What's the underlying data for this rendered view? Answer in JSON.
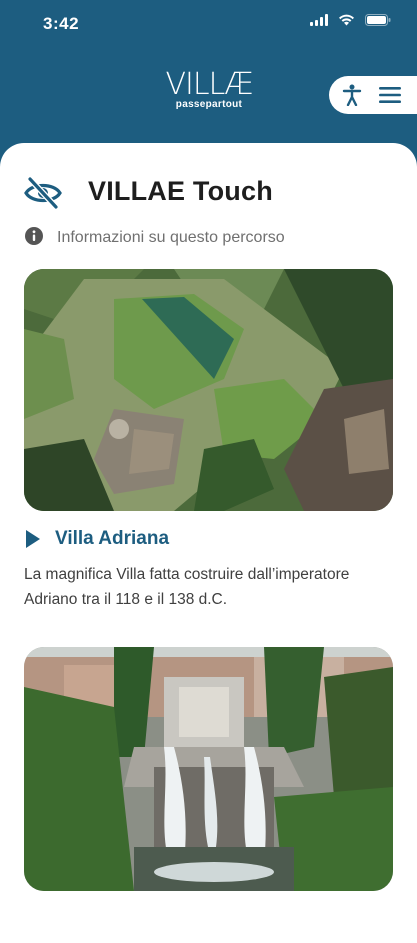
{
  "status_bar": {
    "time": "3:42"
  },
  "header": {
    "logo_main": "VILLÆ",
    "logo_sub": "passepartout"
  },
  "page": {
    "title": "VILLAE Touch",
    "info_text": "Informazioni su questo percorso"
  },
  "items": [
    {
      "title": "Villa Adriana",
      "description": "La magnifica Villa fatta costruire dall’imperatore Adriano tra il 118 e il 138 d.C."
    }
  ],
  "colors": {
    "brand": "#1d5d80",
    "text_dark": "#1e1e1e",
    "text_muted": "#707070"
  },
  "icons": {
    "status": [
      "signal-icon",
      "wifi-icon",
      "battery-icon"
    ],
    "header": [
      "accessibility-icon",
      "menu-icon"
    ],
    "title": "eye-slash-icon",
    "info": "info-icon",
    "play": "play-icon"
  }
}
